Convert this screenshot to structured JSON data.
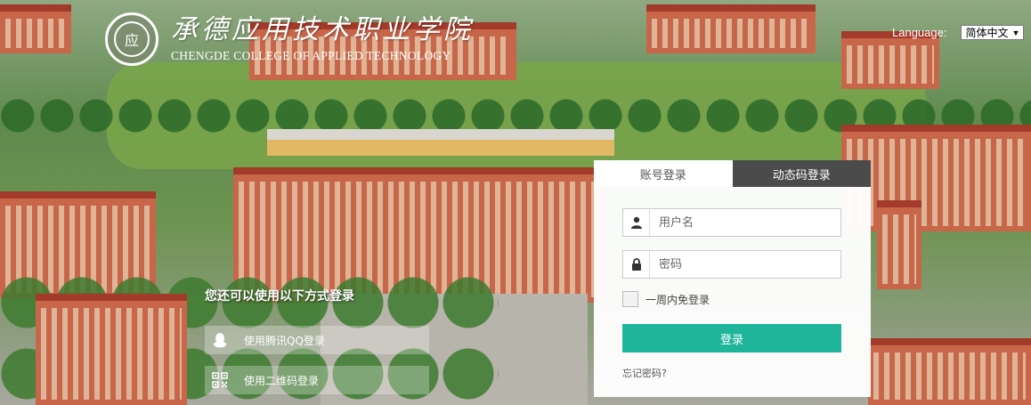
{
  "header": {
    "logo_cn": "承德应用技术职业学院",
    "logo_en": "CHENGDE COLLEGE OF APPLIED TECHNOLOGY",
    "logo_seal_char": "应"
  },
  "language": {
    "label": "Language:",
    "selected": "简体中文"
  },
  "alt_login": {
    "title": "您还可以使用以下方式登录",
    "qq_label": "使用腾讯QQ登录",
    "qr_label": "使用二维码登录"
  },
  "login": {
    "tabs": [
      {
        "label": "账号登录",
        "active": true
      },
      {
        "label": "动态码登录",
        "active": false
      }
    ],
    "username_placeholder": "用户名",
    "password_placeholder": "密码",
    "remember_label": "一周内免登录",
    "submit_label": "登录",
    "forgot_label": "忘记密码?"
  },
  "colors": {
    "accent": "#1fb59a",
    "tab_inactive": "#4b4b4b"
  },
  "icons": {
    "user": "user-icon",
    "lock": "lock-icon",
    "qq": "qq-penguin-icon",
    "qr": "qr-code-icon",
    "dropdown": "dropdown-arrow-icon"
  }
}
